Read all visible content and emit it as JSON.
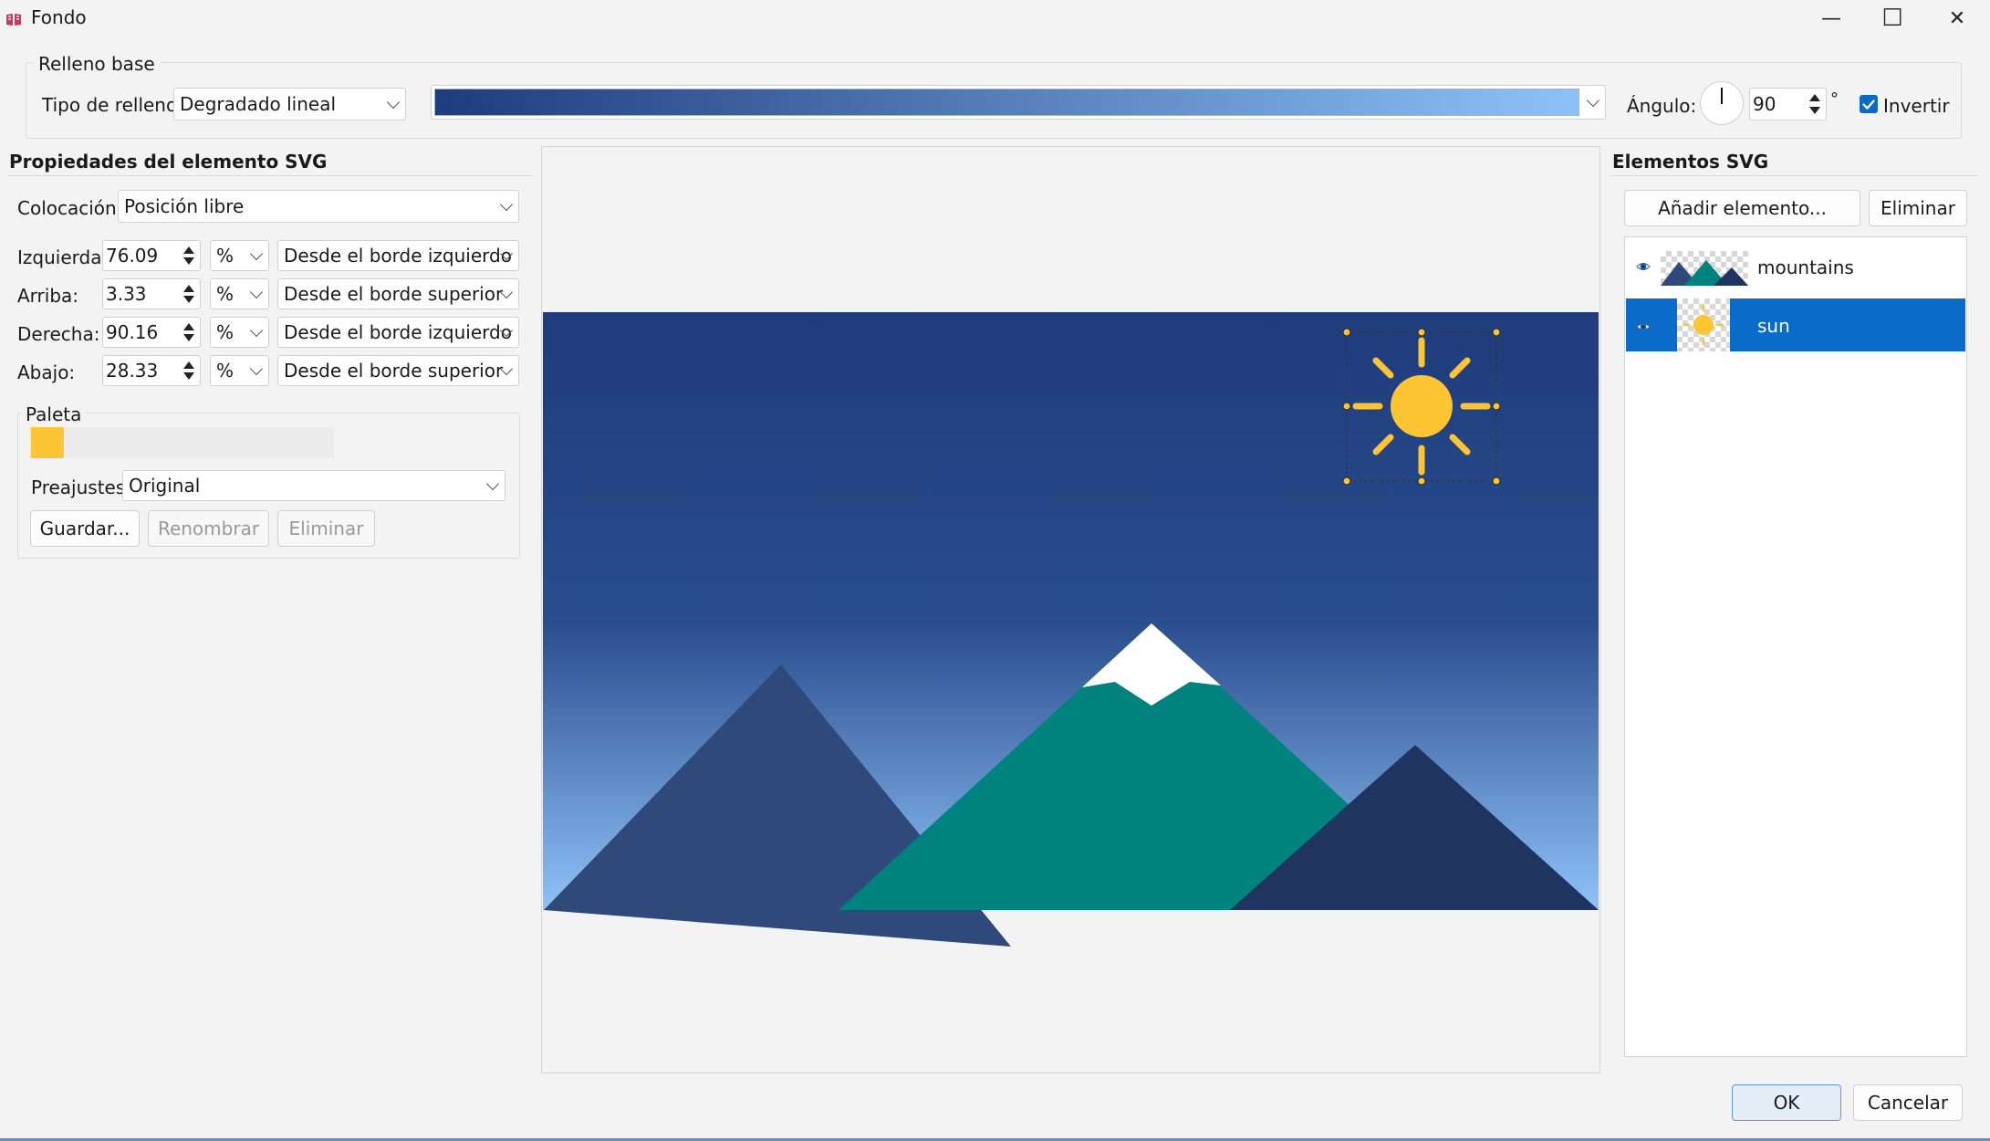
{
  "window": {
    "title": "Fondo",
    "controls": {
      "minimize": "—",
      "maximize": "☐",
      "close": "✕"
    }
  },
  "base_fill": {
    "group_label": "Relleno base",
    "fill_type_label": "Tipo de relleno:",
    "fill_type_value": "Degradado lineal",
    "gradient": {
      "start_color": "#1f3c7c",
      "end_color": "#8ec2f7"
    },
    "angle_label": "Ángulo:",
    "angle_value": "90",
    "degree_symbol": "°",
    "invert_label": "Invertir",
    "invert_checked": true
  },
  "properties": {
    "heading": "Propiedades del elemento SVG",
    "placement_label": "Colocación:",
    "placement_value": "Posición libre",
    "rows": [
      {
        "label": "Izquierda:",
        "value": "76.09",
        "unit": "%",
        "from": "Desde el borde izquierdo"
      },
      {
        "label": "Arriba:",
        "value": "3.33",
        "unit": "%",
        "from": "Desde el borde superior"
      },
      {
        "label": "Derecha:",
        "value": "90.16",
        "unit": "%",
        "from": "Desde el borde izquierdo"
      },
      {
        "label": "Abajo:",
        "value": "28.33",
        "unit": "%",
        "from": "Desde el borde superior"
      }
    ],
    "palette": {
      "label": "Paleta",
      "swatch_color": "#fdc534",
      "presets_label": "Preajustes:",
      "presets_value": "Original",
      "save_label": "Guardar...",
      "rename_label": "Renombrar",
      "delete_label": "Eliminar"
    }
  },
  "preview": {
    "sky_top": "#1f3c7c",
    "sky_bottom": "#8ec2f7",
    "sun_color": "#fdc534",
    "mountain_left": "#2f4a7a",
    "mountain_center": "#00827f",
    "mountain_right": "#1f3560",
    "snow": "#ffffff"
  },
  "elements": {
    "heading": "Elementos SVG",
    "add_label": "Añadir elemento...",
    "delete_label": "Eliminar",
    "items": [
      {
        "name": "mountains",
        "visible": true,
        "selected": false
      },
      {
        "name": "sun",
        "visible": true,
        "selected": true
      }
    ]
  },
  "footer": {
    "ok_label": "OK",
    "cancel_label": "Cancelar"
  }
}
